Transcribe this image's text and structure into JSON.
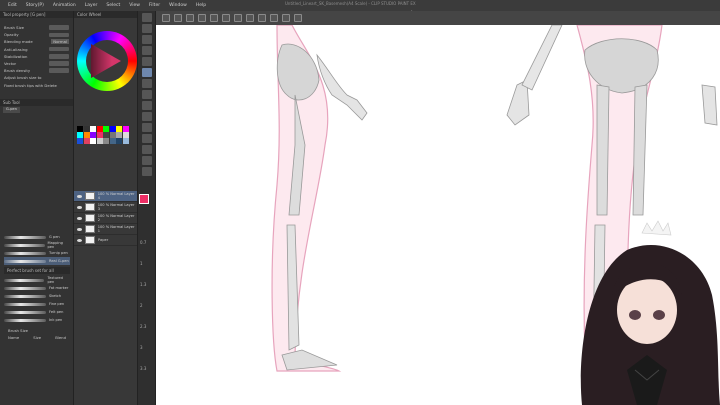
{
  "window": {
    "title": "Untitled_Lineart_SK_Basemesh(A4 Scale) - CLIP STUDIO PAINT EX"
  },
  "menu": {
    "items": [
      "Edit",
      "Story(P)",
      "Animation",
      "Layer",
      "Select",
      "View",
      "Filter",
      "Window",
      "Help"
    ]
  },
  "tool_property": {
    "title": "Tool property [G pen]",
    "brush_size_label": "Brush Size",
    "opacity_label": "Opacity",
    "blending_mode_label": "Blending mode",
    "blending_mode_value": "Normal",
    "anti_aliasing_label": "Anti-aliasing",
    "stabilization_label": "Stabilization",
    "vector_label": "Vector",
    "brush_density_label": "Brush density",
    "adjust_label": "Adjust brush size to",
    "fixed_label": "Fixed brush tips with Delete"
  },
  "sub_tool": {
    "title": "Sub Tool",
    "tab_label": "G-pen",
    "brushes": [
      "G pen",
      "Mapping pen",
      "Turnip pen",
      "Real G-pen",
      "Textured pen",
      "Fat marker",
      "Sketch",
      "Fine pen",
      "Felt pen",
      "Ink pen"
    ],
    "footer": "Brush Size",
    "section2_title": "Perfect brush set for all",
    "section3": [
      "Name",
      "Size",
      "Blend"
    ]
  },
  "color_panel": {
    "title": "Color Wheel",
    "accent": "#ee2f66"
  },
  "layers": {
    "items": [
      {
        "name": "100 % Normal Layer 4"
      },
      {
        "name": "100 % Normal Layer 3"
      },
      {
        "name": "100 % Normal Layer 2"
      },
      {
        "name": "100 % Normal Layer 1"
      },
      {
        "name": "Paper"
      }
    ]
  },
  "ruler": [
    "0.7",
    "1",
    "1.3",
    "2",
    "2.3",
    "3",
    "3.3"
  ],
  "palette_colors": [
    "#000000",
    "#333333",
    "#ffffff",
    "#ff0000",
    "#00ff00",
    "#0000ff",
    "#ffff00",
    "#ff00ff",
    "#00ffff",
    "#ff8800",
    "#8800ff",
    "#ee2f66",
    "#444444",
    "#777777",
    "#aaaaaa",
    "#dddddd",
    "#1a4fd8",
    "#e04060",
    "#ffffff",
    "#cccccc",
    "#888888",
    "#446688",
    "#224466",
    "#99bbdd"
  ]
}
